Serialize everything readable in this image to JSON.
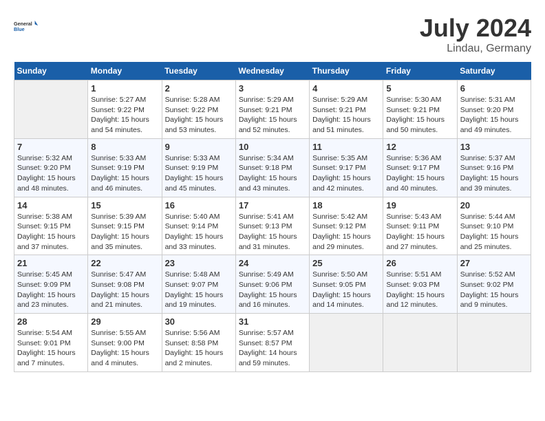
{
  "header": {
    "logo_general": "General",
    "logo_blue": "Blue",
    "title": "July 2024",
    "location": "Lindau, Germany"
  },
  "columns": [
    "Sunday",
    "Monday",
    "Tuesday",
    "Wednesday",
    "Thursday",
    "Friday",
    "Saturday"
  ],
  "weeks": [
    {
      "days": [
        null,
        {
          "num": "1",
          "sunrise": "Sunrise: 5:27 AM",
          "sunset": "Sunset: 9:22 PM",
          "daylight": "Daylight: 15 hours and 54 minutes."
        },
        {
          "num": "2",
          "sunrise": "Sunrise: 5:28 AM",
          "sunset": "Sunset: 9:22 PM",
          "daylight": "Daylight: 15 hours and 53 minutes."
        },
        {
          "num": "3",
          "sunrise": "Sunrise: 5:29 AM",
          "sunset": "Sunset: 9:21 PM",
          "daylight": "Daylight: 15 hours and 52 minutes."
        },
        {
          "num": "4",
          "sunrise": "Sunrise: 5:29 AM",
          "sunset": "Sunset: 9:21 PM",
          "daylight": "Daylight: 15 hours and 51 minutes."
        },
        {
          "num": "5",
          "sunrise": "Sunrise: 5:30 AM",
          "sunset": "Sunset: 9:21 PM",
          "daylight": "Daylight: 15 hours and 50 minutes."
        },
        {
          "num": "6",
          "sunrise": "Sunrise: 5:31 AM",
          "sunset": "Sunset: 9:20 PM",
          "daylight": "Daylight: 15 hours and 49 minutes."
        }
      ]
    },
    {
      "days": [
        {
          "num": "7",
          "sunrise": "Sunrise: 5:32 AM",
          "sunset": "Sunset: 9:20 PM",
          "daylight": "Daylight: 15 hours and 48 minutes."
        },
        {
          "num": "8",
          "sunrise": "Sunrise: 5:33 AM",
          "sunset": "Sunset: 9:19 PM",
          "daylight": "Daylight: 15 hours and 46 minutes."
        },
        {
          "num": "9",
          "sunrise": "Sunrise: 5:33 AM",
          "sunset": "Sunset: 9:19 PM",
          "daylight": "Daylight: 15 hours and 45 minutes."
        },
        {
          "num": "10",
          "sunrise": "Sunrise: 5:34 AM",
          "sunset": "Sunset: 9:18 PM",
          "daylight": "Daylight: 15 hours and 43 minutes."
        },
        {
          "num": "11",
          "sunrise": "Sunrise: 5:35 AM",
          "sunset": "Sunset: 9:17 PM",
          "daylight": "Daylight: 15 hours and 42 minutes."
        },
        {
          "num": "12",
          "sunrise": "Sunrise: 5:36 AM",
          "sunset": "Sunset: 9:17 PM",
          "daylight": "Daylight: 15 hours and 40 minutes."
        },
        {
          "num": "13",
          "sunrise": "Sunrise: 5:37 AM",
          "sunset": "Sunset: 9:16 PM",
          "daylight": "Daylight: 15 hours and 39 minutes."
        }
      ]
    },
    {
      "days": [
        {
          "num": "14",
          "sunrise": "Sunrise: 5:38 AM",
          "sunset": "Sunset: 9:15 PM",
          "daylight": "Daylight: 15 hours and 37 minutes."
        },
        {
          "num": "15",
          "sunrise": "Sunrise: 5:39 AM",
          "sunset": "Sunset: 9:15 PM",
          "daylight": "Daylight: 15 hours and 35 minutes."
        },
        {
          "num": "16",
          "sunrise": "Sunrise: 5:40 AM",
          "sunset": "Sunset: 9:14 PM",
          "daylight": "Daylight: 15 hours and 33 minutes."
        },
        {
          "num": "17",
          "sunrise": "Sunrise: 5:41 AM",
          "sunset": "Sunset: 9:13 PM",
          "daylight": "Daylight: 15 hours and 31 minutes."
        },
        {
          "num": "18",
          "sunrise": "Sunrise: 5:42 AM",
          "sunset": "Sunset: 9:12 PM",
          "daylight": "Daylight: 15 hours and 29 minutes."
        },
        {
          "num": "19",
          "sunrise": "Sunrise: 5:43 AM",
          "sunset": "Sunset: 9:11 PM",
          "daylight": "Daylight: 15 hours and 27 minutes."
        },
        {
          "num": "20",
          "sunrise": "Sunrise: 5:44 AM",
          "sunset": "Sunset: 9:10 PM",
          "daylight": "Daylight: 15 hours and 25 minutes."
        }
      ]
    },
    {
      "days": [
        {
          "num": "21",
          "sunrise": "Sunrise: 5:45 AM",
          "sunset": "Sunset: 9:09 PM",
          "daylight": "Daylight: 15 hours and 23 minutes."
        },
        {
          "num": "22",
          "sunrise": "Sunrise: 5:47 AM",
          "sunset": "Sunset: 9:08 PM",
          "daylight": "Daylight: 15 hours and 21 minutes."
        },
        {
          "num": "23",
          "sunrise": "Sunrise: 5:48 AM",
          "sunset": "Sunset: 9:07 PM",
          "daylight": "Daylight: 15 hours and 19 minutes."
        },
        {
          "num": "24",
          "sunrise": "Sunrise: 5:49 AM",
          "sunset": "Sunset: 9:06 PM",
          "daylight": "Daylight: 15 hours and 16 minutes."
        },
        {
          "num": "25",
          "sunrise": "Sunrise: 5:50 AM",
          "sunset": "Sunset: 9:05 PM",
          "daylight": "Daylight: 15 hours and 14 minutes."
        },
        {
          "num": "26",
          "sunrise": "Sunrise: 5:51 AM",
          "sunset": "Sunset: 9:03 PM",
          "daylight": "Daylight: 15 hours and 12 minutes."
        },
        {
          "num": "27",
          "sunrise": "Sunrise: 5:52 AM",
          "sunset": "Sunset: 9:02 PM",
          "daylight": "Daylight: 15 hours and 9 minutes."
        }
      ]
    },
    {
      "days": [
        {
          "num": "28",
          "sunrise": "Sunrise: 5:54 AM",
          "sunset": "Sunset: 9:01 PM",
          "daylight": "Daylight: 15 hours and 7 minutes."
        },
        {
          "num": "29",
          "sunrise": "Sunrise: 5:55 AM",
          "sunset": "Sunset: 9:00 PM",
          "daylight": "Daylight: 15 hours and 4 minutes."
        },
        {
          "num": "30",
          "sunrise": "Sunrise: 5:56 AM",
          "sunset": "Sunset: 8:58 PM",
          "daylight": "Daylight: 15 hours and 2 minutes."
        },
        {
          "num": "31",
          "sunrise": "Sunrise: 5:57 AM",
          "sunset": "Sunset: 8:57 PM",
          "daylight": "Daylight: 14 hours and 59 minutes."
        },
        null,
        null,
        null
      ]
    }
  ]
}
